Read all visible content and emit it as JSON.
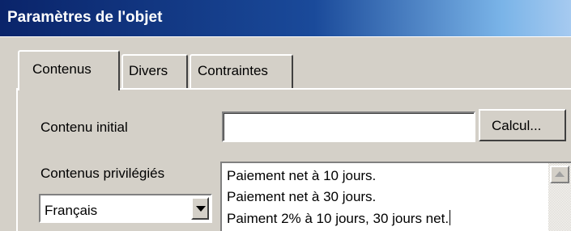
{
  "window": {
    "title": "Paramètres de l'objet"
  },
  "tabs": [
    {
      "label": "Contenus",
      "active": true
    },
    {
      "label": "Divers",
      "active": false
    },
    {
      "label": "Contraintes",
      "active": false
    }
  ],
  "form": {
    "initial_content": {
      "label": "Contenu initial",
      "value": "",
      "button_label": "Calcul..."
    },
    "preferred_contents": {
      "label": "Contenus privilégiés",
      "language_selected": "Français",
      "lines": [
        "Paiement net à 10 jours.",
        "Paiement net à 30 jours.",
        "Paiment 2% à 10 jours, 30  jours net."
      ]
    }
  },
  "colors": {
    "title_gradient_start": "#0a246a",
    "title_gradient_end": "#a6caf0",
    "face": "#d4d0c8"
  },
  "icons": {
    "dropdown": "chevron-down-icon",
    "scroll_up": "scroll-up-arrow-icon"
  }
}
